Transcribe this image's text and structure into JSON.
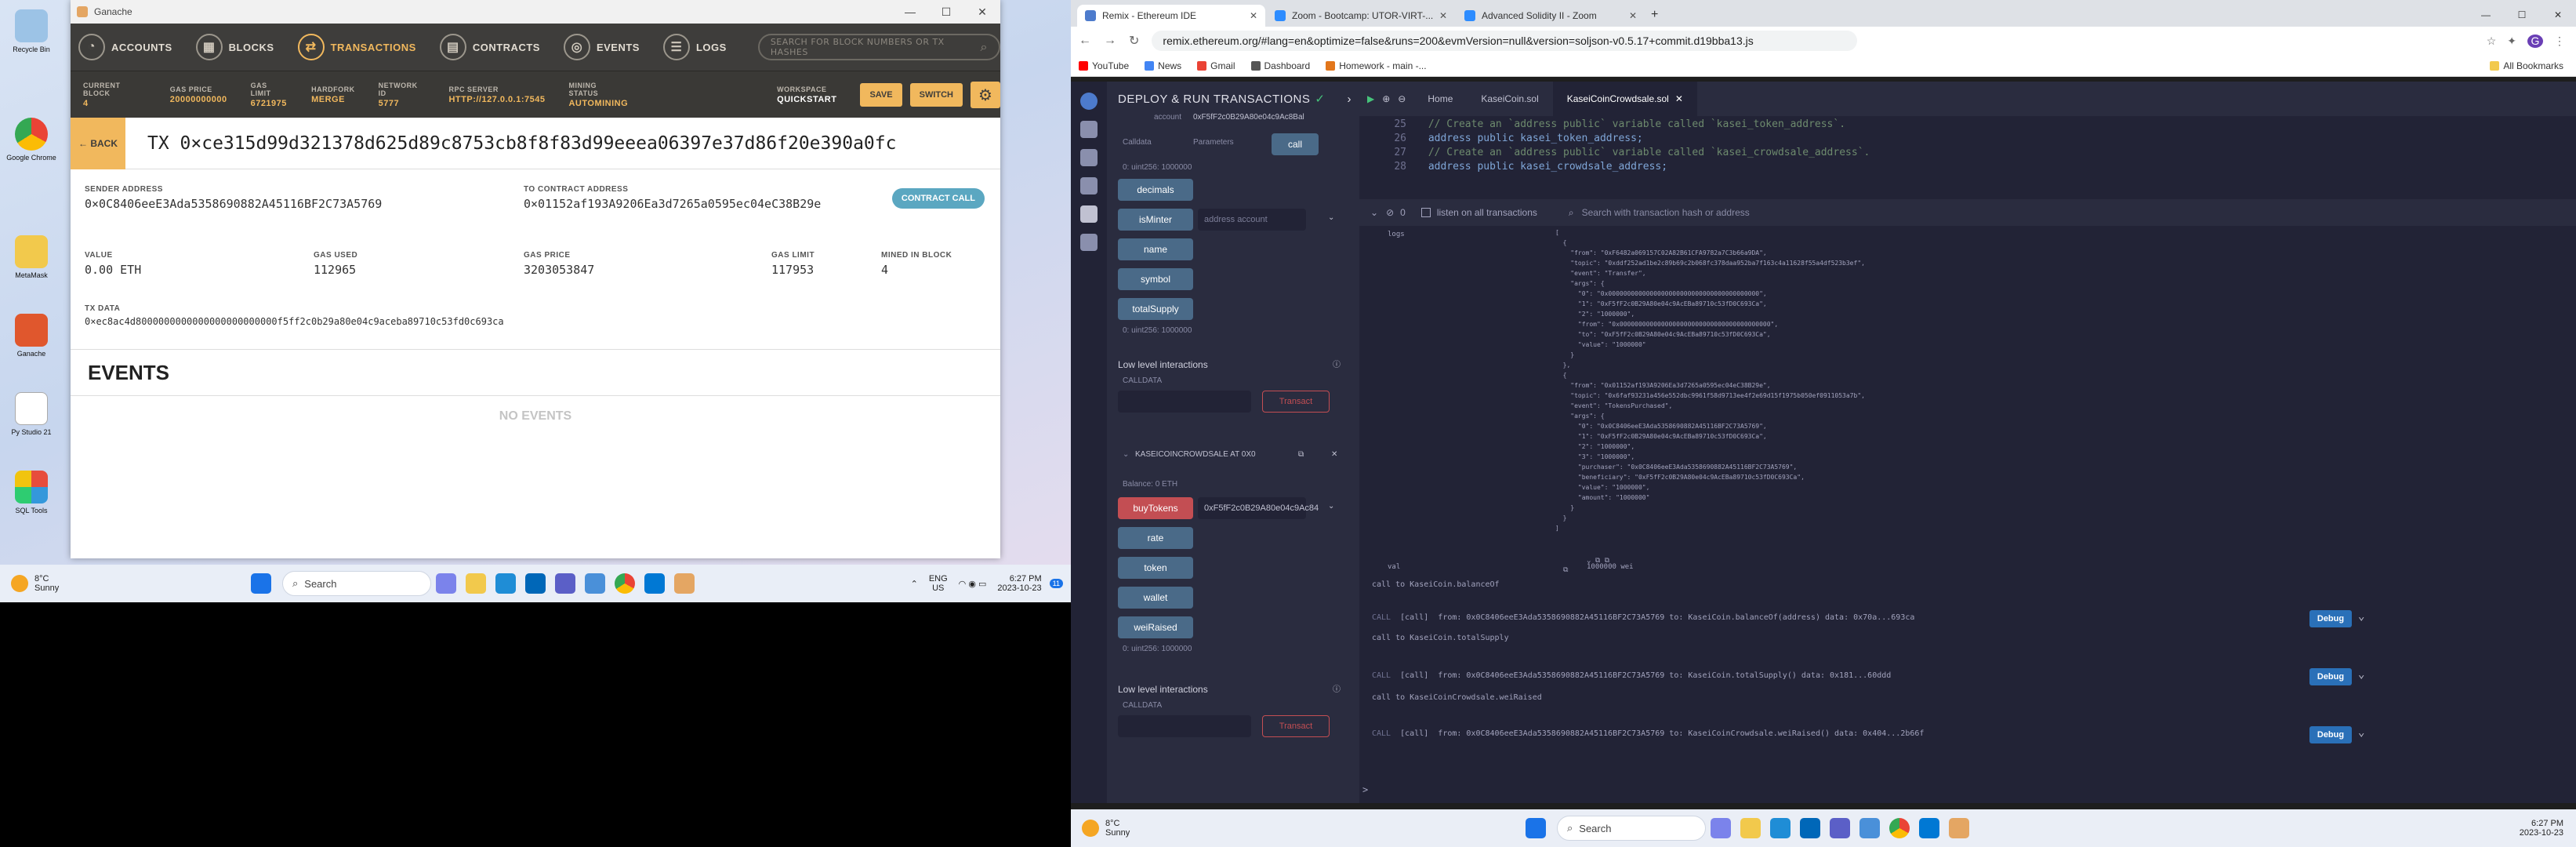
{
  "desktop": {
    "icons": [
      "Recycle Bin",
      "",
      "Google Chrome",
      "",
      "MetaMask",
      "",
      "Ganache",
      "",
      "Py Studio 21",
      "",
      "SQL Tools"
    ]
  },
  "ganache": {
    "window_title": "Ganache",
    "nav": {
      "accounts": "ACCOUNTS",
      "blocks": "BLOCKS",
      "transactions": "TRANSACTIONS",
      "contracts": "CONTRACTS",
      "events": "EVENTS",
      "logs": "LOGS"
    },
    "search_placeholder": "SEARCH FOR BLOCK NUMBERS OR TX HASHES",
    "status": [
      {
        "k": "CURRENT BLOCK",
        "v": "4"
      },
      {
        "k": "GAS PRICE",
        "v": "20000000000"
      },
      {
        "k": "GAS LIMIT",
        "v": "6721975"
      },
      {
        "k": "HARDFORK",
        "v": "MERGE"
      },
      {
        "k": "NETWORK ID",
        "v": "5777"
      },
      {
        "k": "RPC SERVER",
        "v": "HTTP://127.0.0.1:7545"
      },
      {
        "k": "MINING STATUS",
        "v": "AUTOMINING"
      }
    ],
    "workspace_label": "WORKSPACE",
    "workspace_value": "QUICKSTART",
    "save": "SAVE",
    "switch": "SWITCH",
    "back": "← BACK",
    "tx_hash": "TX 0×ce315d99d321378d625d89c8753cb8f8f83d99eeea06397e37d86f20e390a0fc",
    "sender_label": "SENDER ADDRESS",
    "sender": "0×0C8406eeE3Ada5358690882A45116BF2C73A5769",
    "to_label": "TO CONTRACT ADDRESS",
    "to": "0×01152af193A9206Ea3d7265a0595ec04eC38B29e",
    "contract_call": "CONTRACT CALL",
    "value_label": "VALUE",
    "value": "0.00 ETH",
    "gas_used_label": "GAS USED",
    "gas_used": "112965",
    "gas_price_label": "GAS PRICE",
    "gas_price": "3203053847",
    "gas_limit_label": "GAS LIMIT",
    "gas_limit": "117953",
    "mined_label": "MINED IN BLOCK",
    "mined": "4",
    "txdata_label": "TX DATA",
    "txdata": "0×ec8ac4d8000000000000000000000000f5ff2c0b29a80e04c9aceba89710c53fd0c693ca",
    "events_heading": "EVENTS",
    "no_events": "NO EVENTS"
  },
  "taskbar_left": {
    "weather_temp": "8°C",
    "weather_desc": "Sunny",
    "search": "Search",
    "lang": "ENG",
    "region": "US",
    "time": "6:27 PM",
    "date": "2023-10-23",
    "notif": "11"
  },
  "chrome": {
    "tabs": [
      {
        "label": "Remix - Ethereum IDE",
        "color": "#4d7bcc"
      },
      {
        "label": "Zoom - Bootcamp: UTOR-VIRT-...",
        "color": "#2d8cff"
      },
      {
        "label": "Advanced Solidity II - Zoom",
        "color": "#2d8cff"
      }
    ],
    "url": "remix.ethereum.org/#lang=en&optimize=false&runs=200&evmVersion=null&version=soljson-v0.5.17+commit.d19bba13.js",
    "bookmarks": [
      "YouTube",
      "News",
      "Gmail",
      "Dashboard",
      "Homework - main -..."
    ],
    "all_bookmarks": "All Bookmarks"
  },
  "remix": {
    "panel_title": "DEPLOY & RUN TRANSACTIONS",
    "account_label": "account",
    "account_value": "0xF5fF2c0B29A80e04c9Ac8Bal",
    "calldata_tab": "Calldata",
    "params_tab": "Parameters",
    "call_btn": "call",
    "uint_result": "0: uint256: 1000000",
    "buttons1": [
      "decimals",
      "isMinter",
      "name",
      "symbol",
      "totalSupply"
    ],
    "isminter_placeholder": "address account",
    "uint_result2": "0: uint256: 1000000",
    "low_level": "Low level interactions",
    "calldata": "CALLDATA",
    "transact": "Transact",
    "contract_title": "KASEICOINCROWDSALE AT 0X0",
    "balance": "Balance: 0 ETH",
    "buytokens": "buyTokens",
    "buytokens_value": "0xF5fF2c0B29A80e04c9Ac84",
    "buttons2": [
      "rate",
      "token",
      "wallet",
      "weiRaised"
    ],
    "uint_result3": "0: uint256: 1000000",
    "editor_tabs": [
      "Home",
      "KaseiCoin.sol",
      "KaseiCoinCrowdsale.sol"
    ],
    "code": [
      {
        "n": "25",
        "t": "    // Create an `address public` variable called `kasei_token_address`.",
        "c": "cm"
      },
      {
        "n": "26",
        "t": "    address public kasei_token_address;",
        "c": "kw"
      },
      {
        "n": "27",
        "t": "    // Create an `address public` variable called `kasei_crowdsale_address`.",
        "c": "cm"
      },
      {
        "n": "28",
        "t": "    address public kasei_crowdsale_address;",
        "c": "kw"
      }
    ],
    "terminal_count": "0",
    "listen": "listen on all transactions",
    "term_search": "Search with transaction hash or address",
    "logs_label": "logs",
    "log_lines": [
      "[",
      "  {",
      "    \"from\": \"0xF6482a069157C02A82B61CFA9782a7C3b66a9DA\",",
      "    \"topic\": \"0xddf252ad1be2c89b69c2b068fc378daa952ba7f163c4a11628f55a4df523b3ef\",",
      "    \"event\": \"Transfer\",",
      "    \"args\": {",
      "      \"0\": \"0x0000000000000000000000000000000000000000\",",
      "      \"1\": \"0xF5fF2c0B29A80e04c9AcEBa89710c53fD0C693Ca\",",
      "      \"2\": \"1000000\",",
      "      \"from\": \"0x0000000000000000000000000000000000000000\",",
      "      \"to\": \"0xF5fF2c0B29A80e04c9AcEBa89710c53fD0C693Ca\",",
      "      \"value\": \"1000000\"",
      "    }",
      "  },",
      "  {",
      "    \"from\": \"0x01152af193A9206Ea3d7265a0595ec04eC38B29e\",",
      "    \"topic\": \"0x6faf93231a456e552dbc9961f58d9713ee4f2e69d15f1975b050ef0911053a7b\",",
      "    \"event\": \"TokensPurchased\",",
      "    \"args\": {",
      "      \"0\": \"0x0C8406eeE3Ada5358690882A45116BF2C73A5769\",",
      "      \"1\": \"0xF5fF2c0B29A80e04c9AcEBa89710c53fD0C693Ca\",",
      "      \"2\": \"1000000\",",
      "      \"3\": \"1000000\",",
      "      \"purchaser\": \"0x0C8406eeE3Ada5358690882A45116BF2C73A5769\",",
      "      \"beneficiary\": \"0xF5fF2c0B29A80e04c9AcEBa89710c53fD0C693Ca\",",
      "      \"value\": \"1000000\",",
      "      \"amount\": \"1000000\"",
      "    }",
      "  }",
      "]"
    ],
    "val_label": "val",
    "val_value": "1000000 wei",
    "calls": [
      {
        "title": "call to KaseiCoin.balanceOf",
        "line": "[call]  from: 0x0C8406eeE3Ada5358690882A45116BF2C73A5769 to: KaseiCoin.balanceOf(address) data: 0x70a...693ca"
      },
      {
        "title": "call to KaseiCoin.totalSupply",
        "line": "[call]  from: 0x0C8406eeE3Ada5358690882A45116BF2C73A5769 to: KaseiCoin.totalSupply() data: 0x181...60ddd"
      },
      {
        "title": "call to KaseiCoinCrowdsale.weiRaised",
        "line": "[call]  from: 0x0C8406eeE3Ada5358690882A45116BF2C73A5769 to: KaseiCoinCrowdsale.weiRaised() data: 0x404...2b66f"
      }
    ],
    "debug": "Debug",
    "prompt": ">"
  },
  "taskbar_right": {
    "weather_temp": "8°C",
    "weather_desc": "Sunny",
    "search": "Search",
    "time": "6:27 PM",
    "date": "2023-10-23"
  }
}
